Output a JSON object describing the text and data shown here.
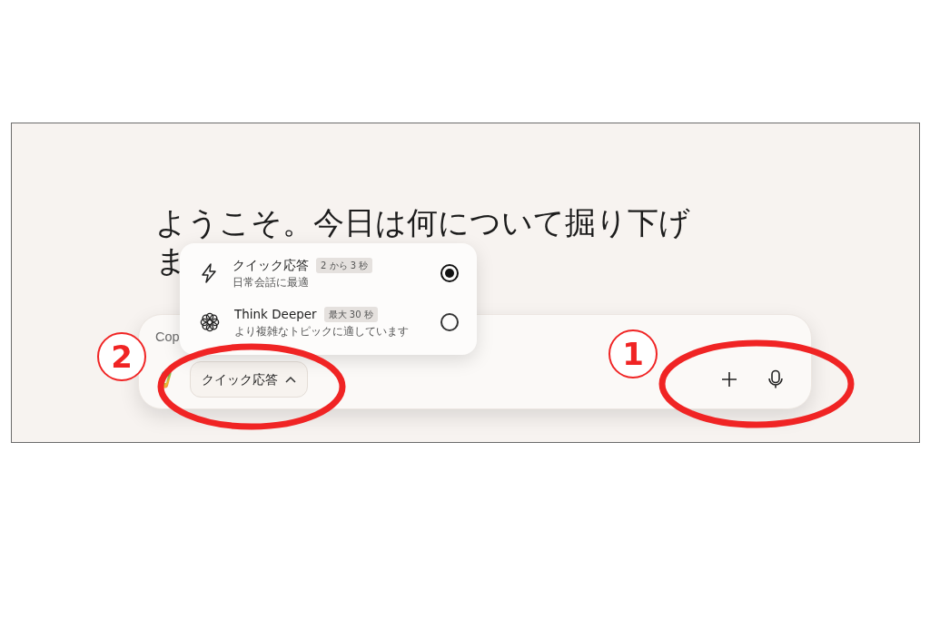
{
  "heading": {
    "lines": [
      "ようこそ。今日は何について掘り下げ",
      "ま"
    ]
  },
  "composer": {
    "placeholder": "Cop",
    "mode_button": {
      "label": "クイック応答",
      "expanded": true
    }
  },
  "mode_menu": [
    {
      "kind": "bolt",
      "title": "クイック応答",
      "badge": "2 から 3 秒",
      "subtitle": "日常会話に最適",
      "selected": true
    },
    {
      "kind": "flower",
      "title": "Think Deeper",
      "badge": "最大 30 秒",
      "subtitle": "より複雑なトピックに適しています",
      "selected": false
    }
  ],
  "annotations": [
    {
      "label": "2"
    },
    {
      "label": "1"
    }
  ]
}
